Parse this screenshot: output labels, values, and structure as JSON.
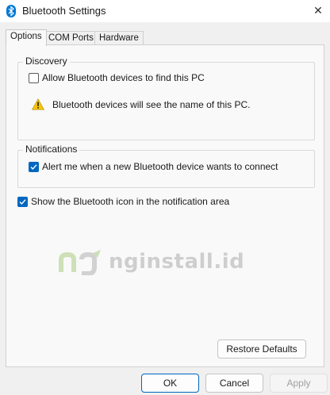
{
  "window": {
    "title": "Bluetooth Settings",
    "close_glyph": "✕"
  },
  "tabs": [
    {
      "label": "Options",
      "active": true
    },
    {
      "label": "COM Ports",
      "active": false
    },
    {
      "label": "Hardware",
      "active": false
    }
  ],
  "discovery": {
    "legend": "Discovery",
    "allow_label": "Allow Bluetooth devices to find this PC",
    "allow_checked": false,
    "warning_text": "Bluetooth devices will see the name of this PC."
  },
  "notifications": {
    "legend": "Notifications",
    "alert_label": "Alert me when a new Bluetooth device wants to connect",
    "alert_checked": true
  },
  "show_icon": {
    "label": "Show the Bluetooth icon in the notification area",
    "checked": true
  },
  "watermark": {
    "text": "nginstall.id"
  },
  "buttons": {
    "restore_defaults": "Restore Defaults",
    "ok": "OK",
    "cancel": "Cancel",
    "apply": "Apply"
  },
  "colors": {
    "accent": "#0067c0",
    "warning": "#f7c600"
  }
}
